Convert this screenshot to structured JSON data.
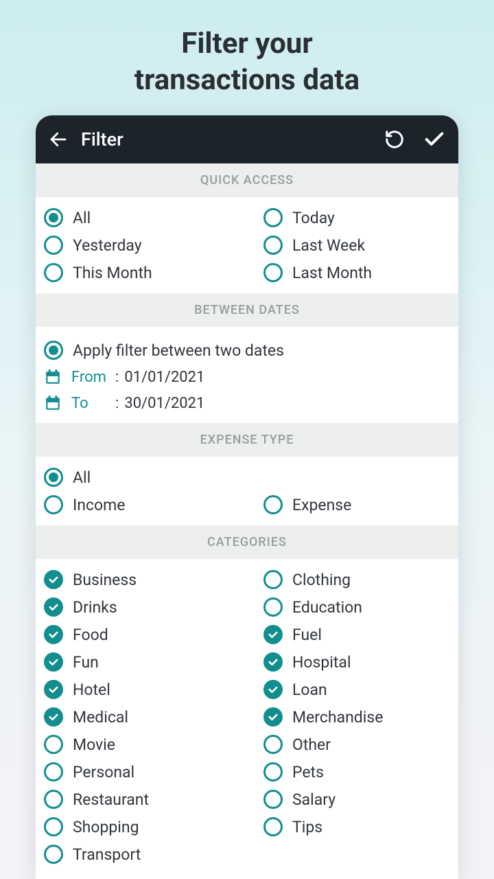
{
  "promo": {
    "line1": "Filter your",
    "line2": "transactions data"
  },
  "header": {
    "title": "Filter"
  },
  "sections": {
    "quick_access": {
      "title": "QUICK ACCESS",
      "left": [
        {
          "label": "All",
          "selected": true
        },
        {
          "label": "Yesterday",
          "selected": false
        },
        {
          "label": "This Month",
          "selected": false
        }
      ],
      "right": [
        {
          "label": "Today",
          "selected": false
        },
        {
          "label": "Last Week",
          "selected": false
        },
        {
          "label": "Last Month",
          "selected": false
        }
      ]
    },
    "between_dates": {
      "title": "BETWEEN DATES",
      "apply_label": "Apply filter between two dates",
      "apply_selected": true,
      "from_label": "From",
      "from_value": "01/01/2021",
      "to_label": "To",
      "to_value": "30/01/2021"
    },
    "expense_type": {
      "title": "EXPENSE TYPE",
      "left": [
        {
          "label": "All",
          "selected": true
        },
        {
          "label": "Income",
          "selected": false
        }
      ],
      "right": [
        {
          "label": "Expense",
          "selected": false
        }
      ]
    },
    "categories": {
      "title": "CATEGORIES",
      "left": [
        {
          "label": "Business",
          "checked": true
        },
        {
          "label": "Drinks",
          "checked": true
        },
        {
          "label": "Food",
          "checked": true
        },
        {
          "label": "Fun",
          "checked": true
        },
        {
          "label": "Hotel",
          "checked": true
        },
        {
          "label": "Medical",
          "checked": true
        },
        {
          "label": "Movie",
          "checked": false
        },
        {
          "label": "Personal",
          "checked": false
        },
        {
          "label": "Restaurant",
          "checked": false
        },
        {
          "label": "Shopping",
          "checked": false
        },
        {
          "label": "Transport",
          "checked": false
        }
      ],
      "right": [
        {
          "label": "Clothing",
          "checked": false
        },
        {
          "label": "Education",
          "checked": false
        },
        {
          "label": "Fuel",
          "checked": true
        },
        {
          "label": "Hospital",
          "checked": true
        },
        {
          "label": "Loan",
          "checked": true
        },
        {
          "label": "Merchandise",
          "checked": true
        },
        {
          "label": "Other",
          "checked": false
        },
        {
          "label": "Pets",
          "checked": false
        },
        {
          "label": "Salary",
          "checked": false
        },
        {
          "label": "Tips",
          "checked": false
        }
      ]
    }
  }
}
